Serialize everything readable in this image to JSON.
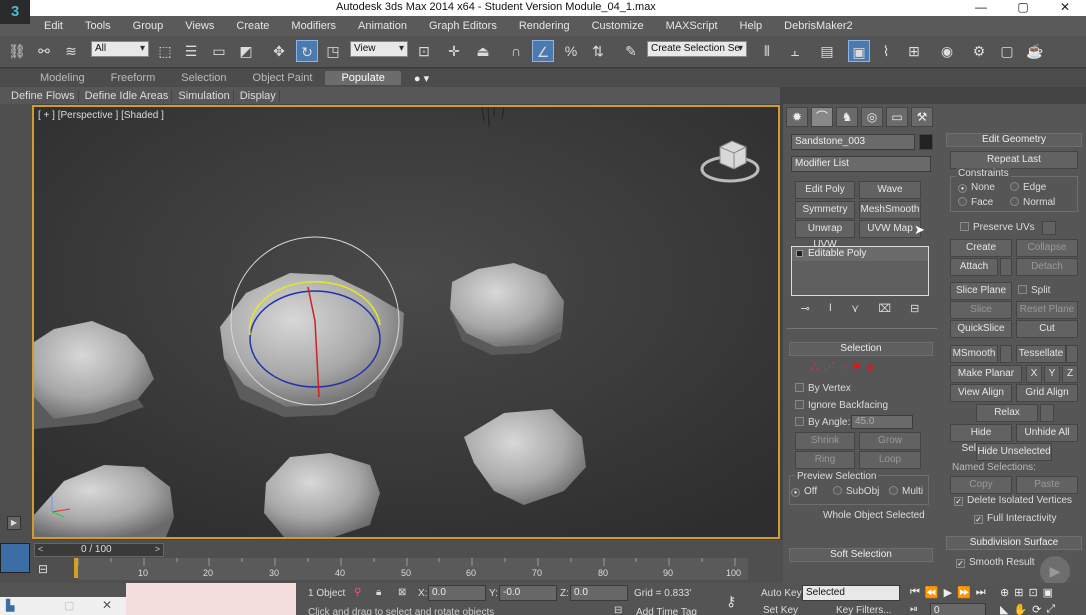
{
  "app": {
    "title": "Autodesk 3ds Max  2014 x64  - Student Version     Module_04_1.max",
    "logo_text": "3",
    "window_buttons": [
      "—",
      "▢",
      "✕"
    ]
  },
  "menu": [
    "Edit",
    "Tools",
    "Group",
    "Views",
    "Create",
    "Modifiers",
    "Animation",
    "Graph Editors",
    "Rendering",
    "Customize",
    "MAXScript",
    "Help",
    "DebrisMaker2"
  ],
  "toolbar": {
    "filter_value": "All",
    "refcoord_value": "View",
    "named_selection_placeholder": "Create Selection Se"
  },
  "ribbon": {
    "tabs": [
      "Modeling",
      "Freeform",
      "Selection",
      "Object Paint",
      "Populate"
    ],
    "active_tab": "Populate",
    "subtabs": [
      "Define Flows",
      "Define Idle Areas",
      "Simulation",
      "Display"
    ]
  },
  "viewport": {
    "label": "[ + ] [Perspective ] [Shaded ]",
    "border_color": "#d49a2c"
  },
  "command_panel": {
    "object_name": "Sandstone_003",
    "modifier_list": "Modifier List",
    "modifier_buttons": [
      "Edit Poly",
      "Wave",
      "Symmetry",
      "MeshSmooth",
      "Unwrap UVW",
      "UVW Map"
    ],
    "stack_item": "Editable Poly",
    "selection": {
      "title": "Selection",
      "by_vertex": "By Vertex",
      "ignore_backfacing": "Ignore Backfacing",
      "by_angle": "By Angle:",
      "angle_value": "45.0",
      "shrink": "Shrink",
      "grow": "Grow",
      "ring": "Ring",
      "loop": "Loop",
      "preview_title": "Preview Selection",
      "preview_options": [
        "Off",
        "SubObj",
        "Multi"
      ],
      "status": "Whole Object Selected"
    },
    "soft_selection": "Soft Selection"
  },
  "edit_geometry": {
    "title": "Edit Geometry",
    "repeat_last": "Repeat Last",
    "constraints_title": "Constraints",
    "constraints": [
      "None",
      "Edge",
      "Face",
      "Normal"
    ],
    "preserve_uvs": "Preserve UVs",
    "create": "Create",
    "collapse": "Collapse",
    "attach": "Attach",
    "detach": "Detach",
    "slice_plane": "Slice Plane",
    "split": "Split",
    "slice": "Slice",
    "reset_plane": "Reset Plane",
    "quickslice": "QuickSlice",
    "cut": "Cut",
    "msmooth": "MSmooth",
    "tessellate": "Tessellate",
    "make_planar": "Make Planar",
    "xyz": [
      "X",
      "Y",
      "Z"
    ],
    "view_align": "View Align",
    "grid_align": "Grid Align",
    "relax": "Relax",
    "hide_selected": "Hide Selected",
    "unhide_all": "Unhide All",
    "hide_unselected": "Hide Unselected",
    "named_selections": "Named Selections:",
    "copy": "Copy",
    "paste": "Paste",
    "delete_isolated": "Delete Isolated Vertices",
    "full_interactivity": "Full Interactivity",
    "subdivision_surface": "Subdivision Surface",
    "smooth_result": "Smooth Result"
  },
  "timeline": {
    "frame_counter": "0 / 100",
    "ticks": [
      "10",
      "20",
      "30",
      "40",
      "50",
      "60",
      "70",
      "80",
      "90",
      "100"
    ]
  },
  "status": {
    "object_count": "1 Object",
    "x_label": "X:",
    "x_value": "0.0",
    "y_label": "Y:",
    "y_value": "-0.0",
    "z_label": "Z:",
    "z_value": "0.0",
    "grid": "Grid = 0.833'",
    "prompt": "Click and drag to select and rotate objects",
    "add_time_tag": "Add Time Tag",
    "auto_key": "Auto Key",
    "set_key": "Set Key",
    "key_mode": "Selected",
    "key_filters": "Key Filters...",
    "frame_value": "0"
  }
}
